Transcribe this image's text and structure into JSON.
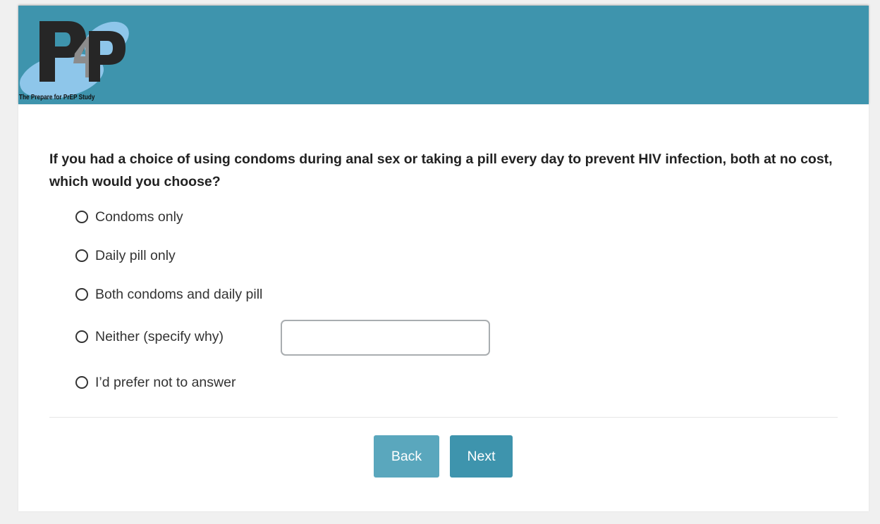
{
  "header": {
    "logo_letters": "P4P",
    "logo_caption": "The Prepare for PrEP Study",
    "background_color": "#3e94ad"
  },
  "question": {
    "text": "If you had a choice of using condoms during anal sex or taking a pill every day to prevent HIV infection, both at no cost, which would you choose?"
  },
  "options": [
    {
      "label": "Condoms only"
    },
    {
      "label": "Daily pill only"
    },
    {
      "label": "Both condoms and daily pill"
    },
    {
      "label": "Neither (specify why)"
    },
    {
      "label": "I’d prefer not to answer"
    }
  ],
  "specify_input": {
    "value": "",
    "placeholder": ""
  },
  "navigation": {
    "back_label": "Back",
    "next_label": "Next"
  },
  "colors": {
    "accent": "#3e94ad",
    "back_button": "#5aa7bd",
    "page_background": "#f0f0f0"
  }
}
